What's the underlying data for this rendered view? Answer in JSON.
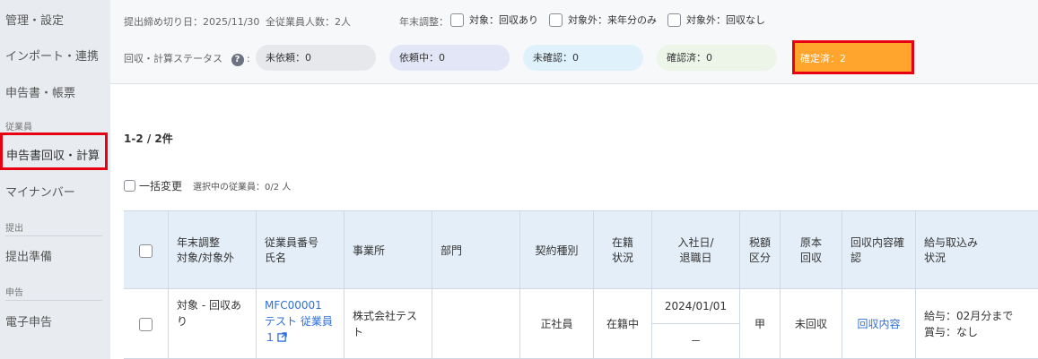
{
  "sidebar": {
    "items": [
      "管理・設定",
      "インポート・連携",
      "申告書・帳票"
    ],
    "section_employee": "従業員",
    "active": "申告書回収・計算",
    "item_mynumber": "マイナンバー",
    "section_submit": "提出",
    "item_prepare": "提出準備",
    "section_report": "申告",
    "item_efile": "電子申告"
  },
  "header": {
    "deadline": "提出締め切り日：2025/11/30",
    "total": "全従業員人数：2人",
    "yearend_label": "年末調整：",
    "filter1": "対象：回収あり",
    "filter2": "対象外：来年分のみ",
    "filter3": "対象外：回収なし",
    "status_label": "回収・計算ステータス",
    "help": "?",
    "statuses": [
      {
        "label": "未依頼：0",
        "color": "#e6e8eb"
      },
      {
        "label": "依頼中：0",
        "color": "#e3e6f6"
      },
      {
        "label": "未確認：0",
        "color": "#dff1fb"
      },
      {
        "label": "確認済：0",
        "color": "#edf5e9"
      },
      {
        "label": "確定済：2",
        "color": "#ffa42c"
      }
    ]
  },
  "list": {
    "count": "1-2 / 2件",
    "bulk_label": "一括変更",
    "selected": "選択中の従業員：0/2 人"
  },
  "table": {
    "headers": [
      "年末調整\n対象/対象外",
      "従業員番号\n氏名",
      "事業所",
      "部門",
      "契約種別",
      "在籍\n状況",
      "入社日/\n退職日",
      "税額\n区分",
      "原本\n回収",
      "回収内容確\n認",
      "給与取込み\n状況"
    ],
    "row": {
      "target": "対象 - 回収あ\nり",
      "emp_no": "MFC00001",
      "emp_name": "テスト 従業員\n１",
      "office": "株式会社テス\nト",
      "dept": "",
      "contract": "正社員",
      "status": "在籍中",
      "hire": "2024/01/01",
      "retire": "－",
      "tax": "甲",
      "original": "未回収",
      "review": "回収内容",
      "payroll": "給与：02月分まで\n賞与：なし"
    }
  }
}
